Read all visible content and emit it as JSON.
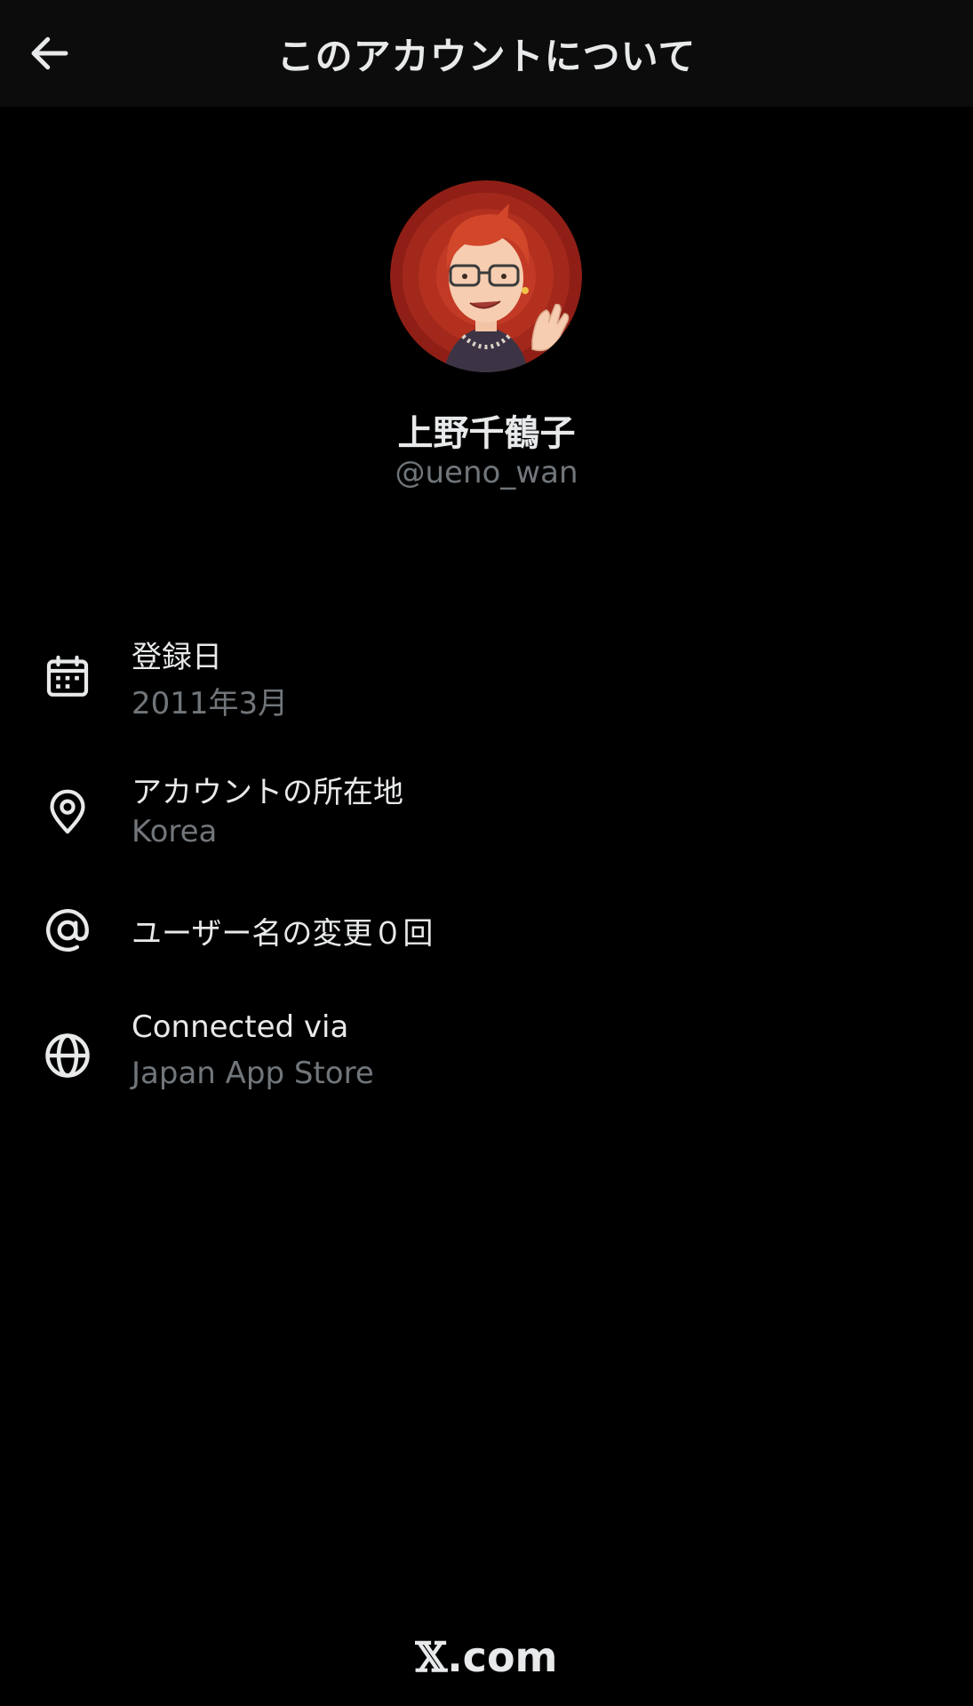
{
  "header": {
    "title": "このアカウントについて",
    "back_icon": "arrow-left-icon"
  },
  "profile": {
    "display_name": "上野千鶴子",
    "handle": "@ueno_wan",
    "avatar_bg_color": "#a3281c"
  },
  "details": [
    {
      "icon": "calendar-icon",
      "label": "登録日",
      "value": "2011年3月"
    },
    {
      "icon": "location-pin-icon",
      "label": "アカウントの所在地",
      "value": "Korea"
    },
    {
      "icon": "at-sign-icon",
      "label": "ユーザー名の変更０回"
    },
    {
      "icon": "globe-icon",
      "label": "Connected via",
      "value": "Japan App Store"
    }
  ],
  "footer": {
    "logo_x": "𝕏",
    "logo_suffix": ".com"
  },
  "colors": {
    "background": "#000000",
    "header_background": "#0c0c0c",
    "primary_text": "#e7e9ea",
    "secondary_text": "#71767b"
  }
}
